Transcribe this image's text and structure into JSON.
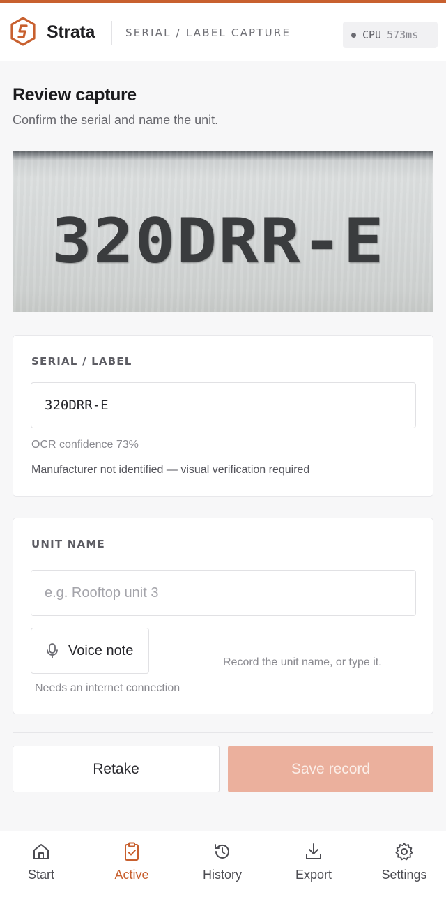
{
  "app": {
    "brand": "Strata",
    "breadcrumb": "SERIAL / LABEL CAPTURE",
    "cpu_label": "CPU",
    "cpu_value": "573ms",
    "accent_color": "#c8602f"
  },
  "review": {
    "title": "Review capture",
    "subtitle": "Confirm the serial and name the unit.",
    "captured_text": "320DRR-E"
  },
  "serial_card": {
    "label": "SERIAL / LABEL",
    "value": "320DRR-E",
    "confidence_text": "OCR confidence 73%",
    "manufacturer_note": "Manufacturer not identified — visual verification required"
  },
  "unit_card": {
    "label": "UNIT NAME",
    "placeholder": "e.g. Rooftop unit 3",
    "voice_button": "Voice note",
    "voice_hint": "Record the unit name, or type it.",
    "voice_requirement": "Needs an internet connection"
  },
  "actions": {
    "retake": "Retake",
    "save": "Save record"
  },
  "nav": {
    "items": [
      {
        "label": "Start",
        "icon": "home-icon"
      },
      {
        "label": "Active",
        "icon": "clipboard-check-icon"
      },
      {
        "label": "History",
        "icon": "history-icon"
      },
      {
        "label": "Export",
        "icon": "download-icon"
      },
      {
        "label": "Settings",
        "icon": "gear-icon"
      }
    ],
    "active_index": 1
  }
}
